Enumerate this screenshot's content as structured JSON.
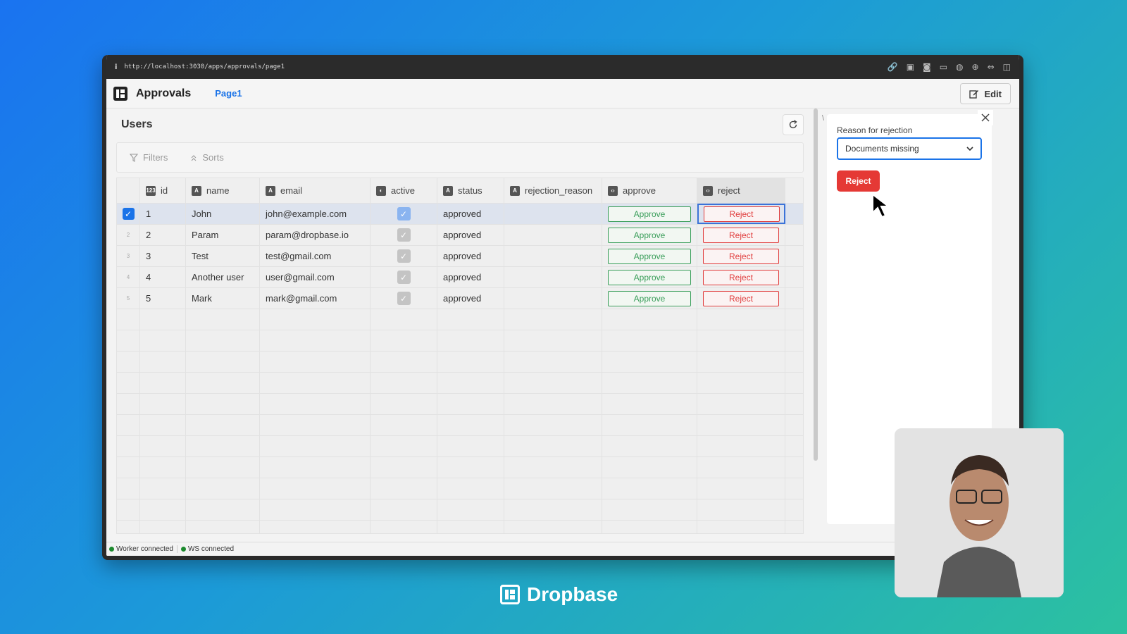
{
  "browser": {
    "url": "http://localhost:3030/apps/approvals/page1",
    "info_icon": "info-icon"
  },
  "app": {
    "title": "Approvals",
    "page_link": "Page1",
    "edit_label": "Edit"
  },
  "users_table": {
    "title": "Users",
    "filters_label": "Filters",
    "sorts_label": "Sorts",
    "columns": [
      {
        "label": "id",
        "type": "123"
      },
      {
        "label": "name",
        "type": "A"
      },
      {
        "label": "email",
        "type": "A"
      },
      {
        "label": "active",
        "type": "toggle"
      },
      {
        "label": "status",
        "type": "A"
      },
      {
        "label": "rejection_reason",
        "type": "A"
      },
      {
        "label": "approve",
        "type": "code"
      },
      {
        "label": "reject",
        "type": "code"
      }
    ],
    "rows": [
      {
        "rownum": "1",
        "id": "1",
        "name": "John",
        "email": "john@example.com",
        "active": true,
        "status": "approved",
        "rejection_reason": "",
        "approve": "Approve",
        "reject": "Reject"
      },
      {
        "rownum": "2",
        "id": "2",
        "name": "Param",
        "email": "param@dropbase.io",
        "active": true,
        "status": "approved",
        "rejection_reason": "",
        "approve": "Approve",
        "reject": "Reject"
      },
      {
        "rownum": "3",
        "id": "3",
        "name": "Test",
        "email": "test@gmail.com",
        "active": true,
        "status": "approved",
        "rejection_reason": "",
        "approve": "Approve",
        "reject": "Reject"
      },
      {
        "rownum": "4",
        "id": "4",
        "name": "Another user",
        "email": "user@gmail.com",
        "active": true,
        "status": "approved",
        "rejection_reason": "",
        "approve": "Approve",
        "reject": "Reject"
      },
      {
        "rownum": "5",
        "id": "5",
        "name": "Mark",
        "email": "mark@gmail.com",
        "active": true,
        "status": "approved",
        "rejection_reason": "",
        "approve": "Approve",
        "reject": "Reject"
      }
    ]
  },
  "side_panel": {
    "reason_label": "Reason for rejection",
    "reason_value": "Documents missing",
    "reject_label": "Reject"
  },
  "status": {
    "worker": "Worker connected",
    "ws": "WS connected",
    "color": "#1c8a2e"
  },
  "brand": {
    "name": "Dropbase"
  },
  "colors": {
    "accent": "#1a73e8",
    "approve": "#3a9e5a",
    "reject": "#e03b3b"
  }
}
